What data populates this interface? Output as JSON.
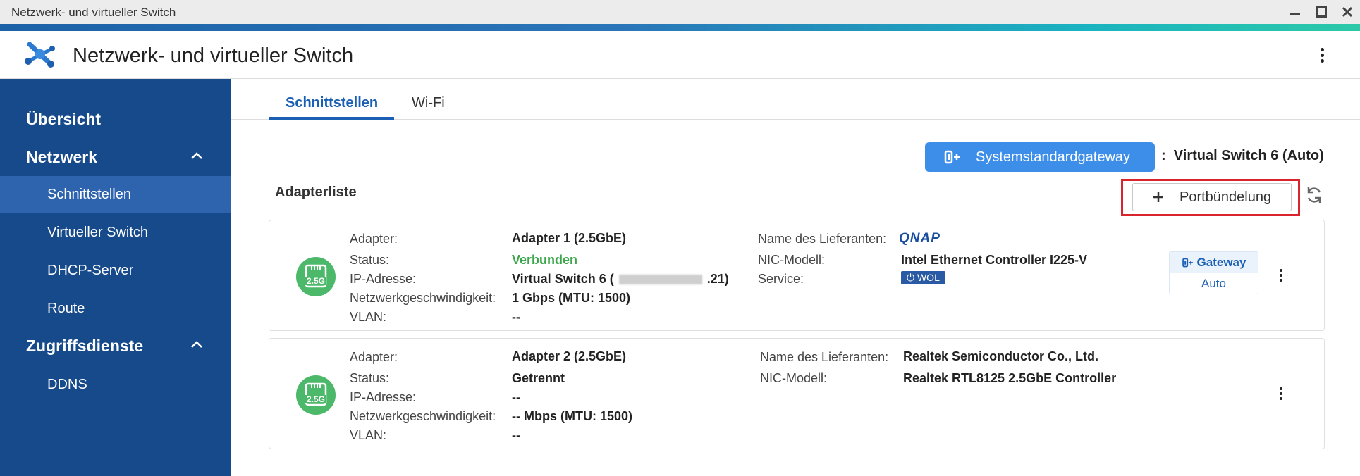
{
  "window": {
    "title": "Netzwerk- und virtueller Switch"
  },
  "header": {
    "app_title": "Netzwerk- und virtueller Switch",
    "app_icon": "network-switch-icon",
    "more_icon": "more-vertical-icon"
  },
  "sidebar": {
    "overview": "Übersicht",
    "network": {
      "label": "Netzwerk",
      "items": [
        "Schnittstellen",
        "Virtueller Switch",
        "DHCP-Server",
        "Route"
      ],
      "active": "Schnittstellen"
    },
    "access": {
      "label": "Zugriffsdienste",
      "items": [
        "DDNS"
      ]
    }
  },
  "tabs": [
    "Schnittstellen",
    "Wi-Fi"
  ],
  "active_tab": "Schnittstellen",
  "gateway": {
    "button_label": "Systemstandardgateway",
    "colon": ":",
    "value": "Virtual Switch 6 (Auto)"
  },
  "adapter_list": {
    "title": "Adapterliste",
    "port_bundle_label": "Portbündelung",
    "add_icon": "plus-icon",
    "refresh_icon": "refresh-icon"
  },
  "labels": {
    "adapter": "Adapter:",
    "status": "Status:",
    "ip": "IP-Adresse:",
    "speed": "Netzwerkgeschwindigkeit:",
    "vlan": "VLAN:",
    "vendor": "Name des Lieferanten:",
    "nic": "NIC-Modell:",
    "service": "Service:"
  },
  "adapters": [
    {
      "name": "Adapter 1 (2.5GbE)",
      "badge": "2.5G",
      "status": "Verbunden",
      "ip_link": "Virtual Switch 6",
      "ip_open": "(",
      "ip_suffix": ".21)",
      "speed": "1 Gbps (MTU: 1500)",
      "vlan": "--",
      "vendor": "QNAP",
      "nic": "Intel Ethernet Controller I225-V",
      "service": "WOL",
      "gateway_label": "Gateway",
      "gateway_mode": "Auto",
      "status_color": "#3aa74a"
    },
    {
      "name": "Adapter 2 (2.5GbE)",
      "badge": "2.5G",
      "status": "Getrennt",
      "ip": "--",
      "speed": "-- Mbps (MTU: 1500)",
      "vlan": "--",
      "vendor": "Realtek Semiconductor Co., Ltd.",
      "nic": "Realtek RTL8125 2.5GbE Controller"
    }
  ],
  "colors": {
    "sidebar": "#174a8b",
    "sidebar_active": "#2e63ae",
    "accent": "#1a5fb4",
    "gateway_button": "#3d8ee8",
    "highlight": "#d9232d",
    "badge_green": "#4cb86a"
  }
}
